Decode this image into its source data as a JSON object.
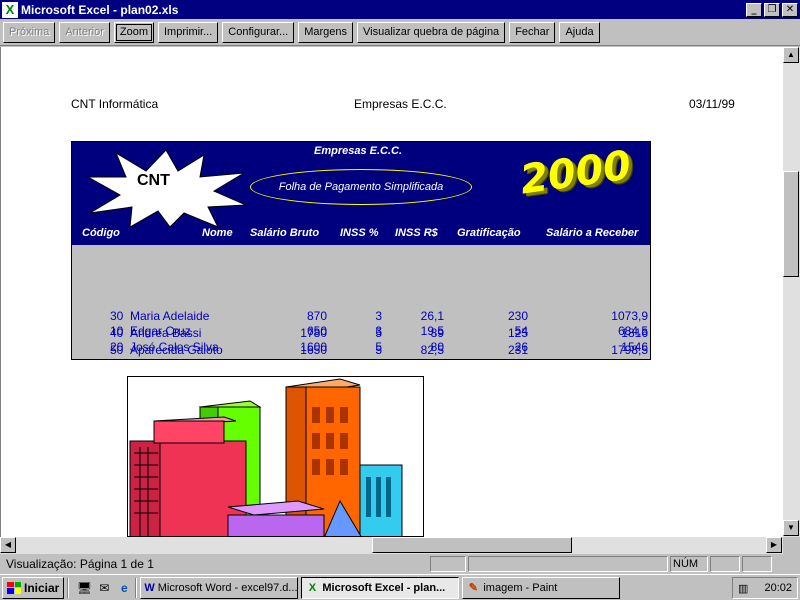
{
  "window": {
    "title": "Microsoft Excel - plan02.xls",
    "app_icon": "excel-icon"
  },
  "toolbar": {
    "next": "Próxima",
    "previous": "Anterior",
    "zoom": "Zoom",
    "print": "Imprimir...",
    "setup": "Configurar...",
    "margins": "Margens",
    "page_break": "Visualizar quebra de página",
    "close": "Fechar",
    "help": "Ajuda"
  },
  "page_header": {
    "left": "CNT Informática",
    "center": "Empresas E.C.C.",
    "right": "03/11/99"
  },
  "banner": {
    "company": "Empresas E.C.C.",
    "logo_text": "CNT",
    "subtitle": "Folha de Pagamento Simplificada",
    "year": "2000"
  },
  "table": {
    "headers": {
      "code": "Código",
      "name": "Nome",
      "gross": "Salário Bruto",
      "inss_pct": "INSS %",
      "inss_value": "INSS R$",
      "bonus": "Gratificação",
      "net": "Salário a Receber"
    },
    "rows": [
      {
        "code": "10",
        "name": "Edgar Cruz",
        "gross": "650",
        "inss_pct": "3",
        "inss_value": "19,5",
        "bonus": "54",
        "net": "684,5"
      },
      {
        "code": "20",
        "name": "José Calos Silva",
        "gross": "1600",
        "inss_pct": "5",
        "inss_value": "80",
        "bonus": "26",
        "net": "1546"
      },
      {
        "code": "30",
        "name": "Maria Adelaide",
        "gross": "870",
        "inss_pct": "3",
        "inss_value": "26,1",
        "bonus": "230",
        "net": "1073,9"
      },
      {
        "code": "40",
        "name": "Andrea Bassi",
        "gross": "1780",
        "inss_pct": "5",
        "inss_value": "89",
        "bonus": "125",
        "net": "1816"
      },
      {
        "code": "50",
        "name": "Aparecida Gaioto",
        "gross": "1650",
        "inss_pct": "5",
        "inss_value": "82,5",
        "bonus": "231",
        "net": "1798,5"
      }
    ]
  },
  "status": {
    "text": "Visualização: Página 1 de 1",
    "num": "NÚM"
  },
  "taskbar": {
    "start": "Iniciar",
    "tasks": [
      {
        "label": "Microsoft Word - excel97.d...",
        "icon": "word-icon",
        "active": false
      },
      {
        "label": "Microsoft Excel - plan...",
        "icon": "excel-icon",
        "active": true
      },
      {
        "label": "imagem - Paint",
        "icon": "paint-icon",
        "active": false
      }
    ],
    "clock": "20:02"
  },
  "colors": {
    "banner_bg": "#00007f",
    "title_bar": "#000080",
    "row_text": "#0000c0",
    "year_yellow": "#ffff00"
  }
}
